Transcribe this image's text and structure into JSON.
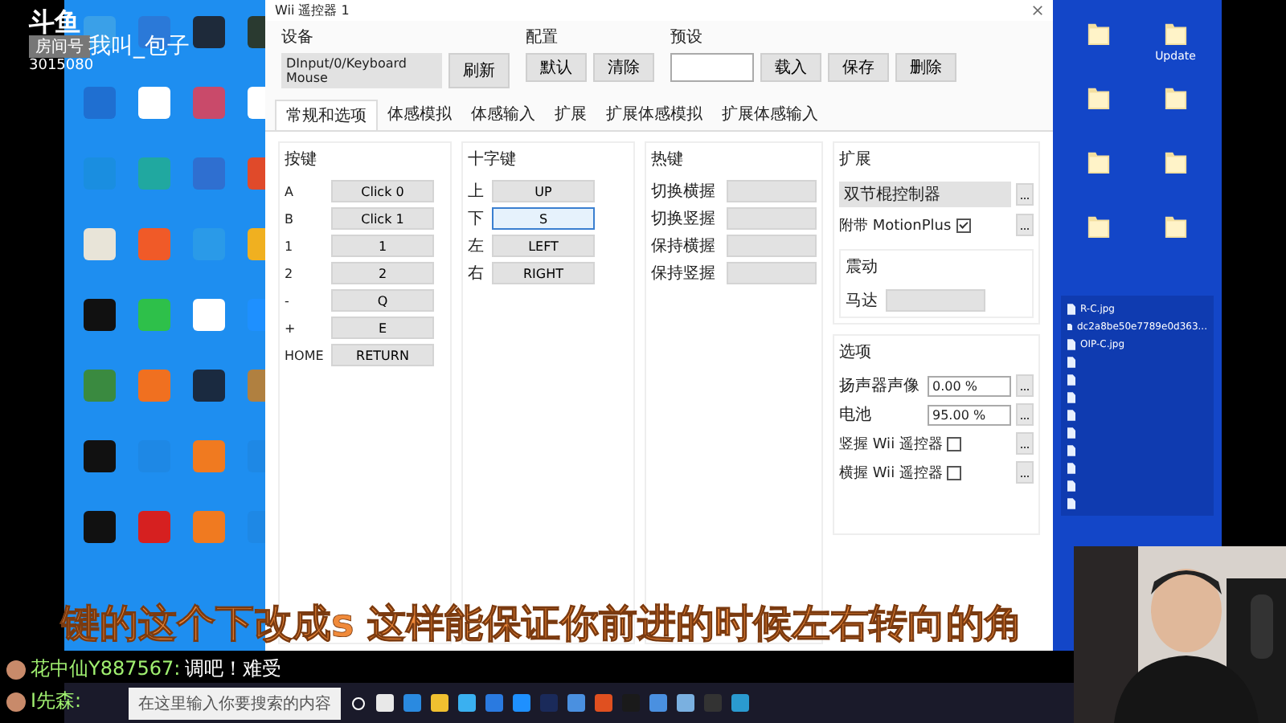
{
  "overlay": {
    "logo": "斗鱼",
    "room_label": "房间号",
    "room_number": "3015080",
    "streamer": "我叫_包子",
    "subtitle": "键的这个下改成s 这样能保证你前进的时候左右转向的角",
    "chat": [
      {
        "user": "花中仙Y887567:",
        "message": "调吧！难受"
      },
      {
        "user": "I先森:"
      }
    ]
  },
  "window": {
    "title": "Wii 遥控器 1",
    "device_label": "设备",
    "device": "DInput/0/Keyboard Mouse",
    "refresh": "刷新",
    "config_label": "配置",
    "config_buttons": [
      "默认",
      "清除"
    ],
    "preset_label": "预设",
    "preset_buttons": [
      "载入",
      "保存",
      "删除"
    ],
    "tabs": [
      {
        "label": "常规和选项",
        "selected": true
      },
      {
        "label": "体感模拟",
        "selected": false
      },
      {
        "label": "体感输入",
        "selected": false
      },
      {
        "label": "扩展",
        "selected": false
      },
      {
        "label": "扩展体感模拟",
        "selected": false
      },
      {
        "label": "扩展体感输入",
        "selected": false
      }
    ],
    "buttons": {
      "title": "按键",
      "items": [
        {
          "label": "A",
          "value": "Click 0"
        },
        {
          "label": "B",
          "value": "Click 1"
        },
        {
          "label": "1",
          "value": "1"
        },
        {
          "label": "2",
          "value": "2"
        },
        {
          "label": "-",
          "value": "Q"
        },
        {
          "label": "+",
          "value": "E"
        },
        {
          "label": "HOME",
          "value": "RETURN"
        }
      ]
    },
    "dpad": {
      "title": "十字键",
      "items": [
        {
          "label": "上",
          "value": "UP",
          "focused": false
        },
        {
          "label": "下",
          "value": "S",
          "focused": true
        },
        {
          "label": "左",
          "value": "LEFT",
          "focused": false
        },
        {
          "label": "右",
          "value": "RIGHT",
          "focused": false
        }
      ]
    },
    "hotkeys": {
      "title": "热键",
      "items": [
        {
          "label": "切换横握"
        },
        {
          "label": "切换竖握"
        },
        {
          "label": "保持横握"
        },
        {
          "label": "保持竖握"
        }
      ]
    },
    "extension": {
      "title": "扩展",
      "device": "双节棍控制器",
      "motionplus": {
        "label": "附带 MotionPlus",
        "checked": true
      }
    },
    "rumble": {
      "title": "震动",
      "label": "马达"
    },
    "options": {
      "title": "选项",
      "spins": [
        {
          "label": "扬声器声像",
          "value": "0.00 %"
        },
        {
          "label": "电池",
          "value": "95.00 %"
        }
      ],
      "checks": [
        {
          "label": "竖握 Wii 遥控器",
          "checked": false
        },
        {
          "label": "横握 Wii 遥控器",
          "checked": false
        }
      ]
    }
  },
  "files_panel": {
    "folders": [
      {
        "label": "Update"
      }
    ],
    "files": [
      {
        "name": "R-C.jpg"
      },
      {
        "name": "dc2a8be50e7789e0d363..."
      },
      {
        "name": "OIP-C.jpg"
      }
    ]
  },
  "taskbar": {
    "search": {
      "placeholder": "在这里输入你要搜索的内容"
    }
  }
}
